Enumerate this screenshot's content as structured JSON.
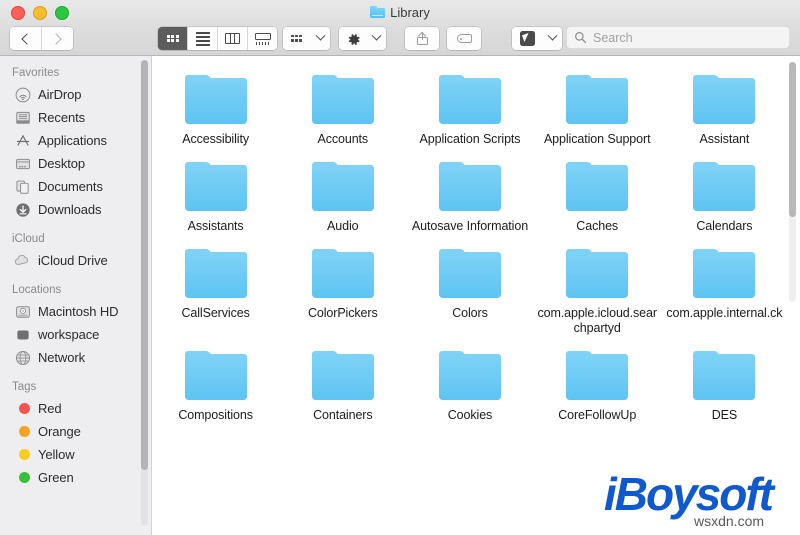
{
  "window": {
    "title": "Library",
    "traffic_lights": [
      {
        "name": "close",
        "color": "#ff5f57"
      },
      {
        "name": "minimize",
        "color": "#febc2e"
      },
      {
        "name": "maximize",
        "color": "#28c840"
      }
    ]
  },
  "toolbar": {
    "back_label": "Back",
    "forward_label": "Forward",
    "view_modes": [
      {
        "name": "icon-view",
        "label": "Icon View",
        "active": true
      },
      {
        "name": "list-view",
        "label": "List View",
        "active": false
      },
      {
        "name": "column-view",
        "label": "Column View",
        "active": false
      },
      {
        "name": "gallery-view",
        "label": "Gallery View",
        "active": false
      }
    ],
    "arrange_label": "Arrange By",
    "action_label": "Action",
    "share_label": "Share",
    "tags_label": "Edit Tags",
    "quick_action_label": "Quick Actions"
  },
  "search": {
    "placeholder": "Search",
    "value": ""
  },
  "sidebar": {
    "sections": [
      {
        "title": "Favorites",
        "items": [
          {
            "label": "AirDrop",
            "icon": "airdrop-icon"
          },
          {
            "label": "Recents",
            "icon": "recents-icon"
          },
          {
            "label": "Applications",
            "icon": "applications-icon"
          },
          {
            "label": "Desktop",
            "icon": "desktop-icon"
          },
          {
            "label": "Documents",
            "icon": "documents-icon"
          },
          {
            "label": "Downloads",
            "icon": "downloads-icon"
          }
        ]
      },
      {
        "title": "iCloud",
        "items": [
          {
            "label": "iCloud Drive",
            "icon": "icloud-drive-icon"
          }
        ]
      },
      {
        "title": "Locations",
        "items": [
          {
            "label": "Macintosh HD",
            "icon": "hard-disk-icon"
          },
          {
            "label": "workspace",
            "icon": "volume-icon"
          },
          {
            "label": "Network",
            "icon": "network-icon"
          }
        ]
      },
      {
        "title": "Tags",
        "items": [
          {
            "label": "Red",
            "icon": "tag-dot-icon",
            "color": "#f8534f"
          },
          {
            "label": "Orange",
            "icon": "tag-dot-icon",
            "color": "#f8a01f"
          },
          {
            "label": "Yellow",
            "icon": "tag-dot-icon",
            "color": "#f9cc1d"
          },
          {
            "label": "Green",
            "icon": "tag-dot-icon",
            "color": "#39c13c"
          }
        ]
      }
    ]
  },
  "content": {
    "files": [
      {
        "name": "Accessibility",
        "type": "folder"
      },
      {
        "name": "Accounts",
        "type": "folder"
      },
      {
        "name": "Application Scripts",
        "type": "folder"
      },
      {
        "name": "Application Support",
        "type": "folder"
      },
      {
        "name": "Assistant",
        "type": "folder"
      },
      {
        "name": "Assistants",
        "type": "folder"
      },
      {
        "name": "Audio",
        "type": "folder"
      },
      {
        "name": "Autosave Information",
        "type": "folder"
      },
      {
        "name": "Caches",
        "type": "folder"
      },
      {
        "name": "Calendars",
        "type": "folder"
      },
      {
        "name": "CallServices",
        "type": "folder"
      },
      {
        "name": "ColorPickers",
        "type": "folder"
      },
      {
        "name": "Colors",
        "type": "folder"
      },
      {
        "name": "com.apple.icloud.searchpartyd",
        "type": "folder"
      },
      {
        "name": "com.apple.internal.ck",
        "type": "folder"
      },
      {
        "name": "Compositions",
        "type": "folder"
      },
      {
        "name": "Containers",
        "type": "folder"
      },
      {
        "name": "Cookies",
        "type": "folder"
      },
      {
        "name": "CoreFollowUp",
        "type": "folder"
      },
      {
        "name": "DES",
        "type": "folder"
      }
    ]
  },
  "watermark": {
    "brand": "iBoysoft",
    "site": "wsxdn.com",
    "brand_color": "#1059cc"
  }
}
